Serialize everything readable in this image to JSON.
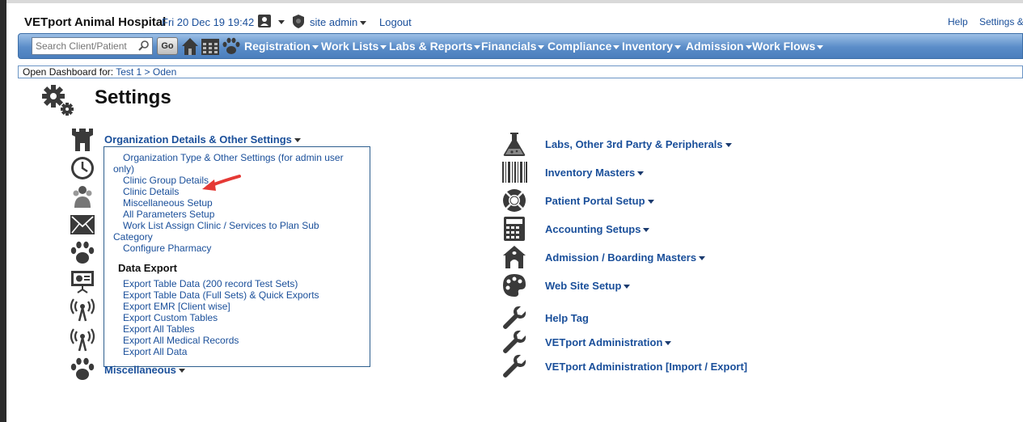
{
  "header": {
    "app_title": "VETport Animal Hospital",
    "datetime": "Fri 20 Dec 19 19:42",
    "user": "site admin",
    "logout": "Logout",
    "help": "Help",
    "settings": "Settings &"
  },
  "nav": {
    "search_placeholder": "Search Client/Patient",
    "go_label": "Go",
    "menus": [
      "Registration",
      "Work Lists",
      "Labs & Reports",
      "Financials",
      "Compliance",
      "Inventory",
      "Admission",
      "Work Flows"
    ]
  },
  "dashboard": {
    "prefix": "Open Dashboard for:",
    "patient": "Test 1 > Oden"
  },
  "page_title": "Settings",
  "left_sections": {
    "org_title": "Organization Details & Other Settings",
    "misc_title": "Miscellaneous"
  },
  "dropdown": {
    "items": [
      "Organization Type & Other Settings (for admin user",
      "only)",
      "Clinic Group Details",
      "Clinic Details",
      "Miscellaneous Setup",
      "All Parameters Setup",
      "Work List Assign Clinic / Services to Plan Sub",
      "Category",
      "Configure Pharmacy"
    ],
    "export_heading": "Data Export",
    "export_items": [
      "Export Table Data (200 record Test Sets)",
      "Export Table Data (Full Sets) & Quick Exports",
      "Export EMR [Client wise]",
      "Export Custom Tables",
      "Export All Tables",
      "Export All Medical Records",
      "Export All Data"
    ]
  },
  "right_links": [
    "Labs, Other 3rd Party & Peripherals",
    "Inventory Masters",
    "Patient Portal Setup",
    "Accounting Setups",
    "Admission / Boarding Masters",
    "Web Site Setup",
    "Help Tag",
    "VETport Administration",
    "VETport Administration [Import / Export]"
  ],
  "colors": {
    "link": "#1a4f9a",
    "navbar": "#5a8cc8",
    "annotation_arrow": "#e53935"
  }
}
